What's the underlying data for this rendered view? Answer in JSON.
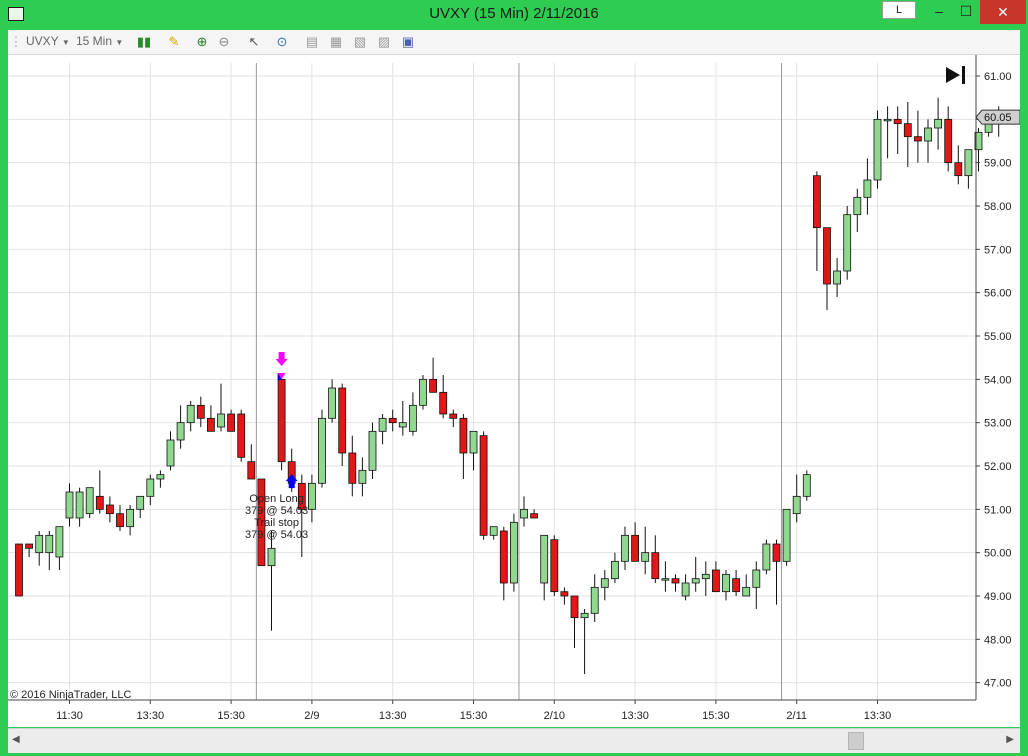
{
  "window": {
    "title": "UVXY (15 Min)  2/11/2016",
    "btn_l": "L",
    "btn_min": "‒",
    "btn_max": "☐",
    "btn_close": "✕"
  },
  "toolbar": {
    "instrument": "UVXY",
    "interval": "15 Min"
  },
  "chart": {
    "copyright": "© 2016 NinjaTrader, LLC",
    "last_price": "60.05",
    "y_ticks": [
      "61.00",
      "60.00",
      "59.00",
      "58.00",
      "57.00",
      "56.00",
      "55.00",
      "54.00",
      "53.00",
      "52.00",
      "51.00",
      "50.00",
      "49.00",
      "48.00",
      "47.00"
    ],
    "x_ticks": [
      "11:30",
      "13:30",
      "15:30",
      "2/9",
      "13:30",
      "15:30",
      "2/10",
      "13:30",
      "15:30",
      "2/11",
      "13:30"
    ],
    "annotations": {
      "entry_name": "Open Long",
      "entry_fill": "379 @ 54.03",
      "exit_name": "Trail stop",
      "exit_fill": "379 @ 54.03"
    },
    "colors": {
      "up": "#90d890",
      "down": "#e01818",
      "wick": "#111111",
      "grid": "#e2e2e2",
      "session": "#9a9a9a",
      "entry_arrow": "#ff00ff",
      "exit_arrow": "#0000ff"
    }
  },
  "chart_data": {
    "type": "candlestick",
    "ylim": [
      46.6,
      61.3
    ],
    "y_tick_values": [
      61,
      60,
      59,
      58,
      57,
      56,
      55,
      54,
      53,
      52,
      51,
      50,
      49,
      48,
      47
    ],
    "x_tick_bar_index": [
      5,
      13,
      21,
      29,
      37,
      45,
      53,
      61,
      69,
      77,
      85
    ],
    "session_breaks_after_bar": [
      23,
      49,
      75
    ],
    "bars": [
      [
        50.2,
        50.2,
        49.0,
        49.0
      ],
      [
        50.2,
        50.1,
        49.9,
        50.1
      ],
      [
        50.0,
        50.5,
        49.7,
        50.4
      ],
      [
        50.0,
        50.5,
        49.6,
        50.4
      ],
      [
        49.9,
        50.6,
        49.6,
        50.6
      ],
      [
        50.8,
        51.6,
        50.6,
        51.4
      ],
      [
        50.8,
        51.5,
        50.6,
        51.4
      ],
      [
        50.9,
        51.5,
        50.8,
        51.5
      ],
      [
        51.3,
        51.9,
        50.9,
        51.0
      ],
      [
        51.1,
        51.3,
        50.7,
        50.9
      ],
      [
        50.9,
        51.1,
        50.5,
        50.6
      ],
      [
        50.6,
        51.1,
        50.4,
        51.0
      ],
      [
        51.0,
        51.3,
        50.8,
        51.3
      ],
      [
        51.3,
        51.8,
        51.1,
        51.7
      ],
      [
        51.7,
        51.9,
        51.5,
        51.8
      ],
      [
        52.0,
        52.8,
        51.9,
        52.6
      ],
      [
        52.6,
        53.4,
        52.4,
        53.0
      ],
      [
        53.0,
        53.5,
        52.8,
        53.4
      ],
      [
        53.4,
        53.6,
        52.9,
        53.1
      ],
      [
        53.1,
        53.4,
        52.8,
        52.8
      ],
      [
        52.9,
        53.9,
        52.8,
        53.2
      ],
      [
        53.2,
        53.3,
        52.8,
        52.8
      ],
      [
        53.2,
        53.3,
        52.1,
        52.2
      ],
      [
        52.1,
        52.5,
        51.7,
        51.7
      ],
      [
        51.7,
        51.7,
        49.7,
        49.7
      ],
      [
        49.7,
        50.5,
        48.2,
        50.1
      ],
      [
        54.0,
        54.0,
        51.9,
        52.1
      ],
      [
        52.1,
        52.4,
        51.4,
        51.6
      ],
      [
        51.6,
        51.8,
        49.9,
        51.0
      ],
      [
        51.0,
        51.8,
        50.7,
        51.6
      ],
      [
        51.6,
        53.3,
        51.5,
        53.1
      ],
      [
        53.1,
        54.0,
        53.0,
        53.8
      ],
      [
        53.8,
        53.9,
        52.0,
        52.3
      ],
      [
        52.3,
        52.7,
        51.3,
        51.6
      ],
      [
        51.6,
        52.2,
        51.3,
        51.9
      ],
      [
        51.9,
        53.0,
        51.7,
        52.8
      ],
      [
        52.8,
        53.2,
        52.5,
        53.1
      ],
      [
        53.1,
        53.3,
        52.8,
        53.0
      ],
      [
        52.9,
        53.5,
        52.7,
        53.0
      ],
      [
        52.8,
        53.7,
        52.7,
        53.4
      ],
      [
        53.4,
        54.1,
        53.3,
        54.0
      ],
      [
        54.0,
        54.5,
        53.7,
        53.7
      ],
      [
        53.7,
        54.1,
        53.1,
        53.2
      ],
      [
        53.2,
        53.3,
        52.9,
        53.1
      ],
      [
        53.1,
        53.2,
        51.7,
        52.3
      ],
      [
        52.3,
        52.8,
        51.9,
        52.8
      ],
      [
        52.7,
        52.8,
        50.3,
        50.4
      ],
      [
        50.4,
        50.6,
        50.3,
        50.6
      ],
      [
        50.5,
        50.6,
        48.9,
        49.3
      ],
      [
        49.3,
        50.9,
        49.1,
        50.7
      ],
      [
        50.8,
        51.3,
        50.6,
        51.0
      ],
      [
        50.9,
        51.0,
        50.8,
        50.8
      ],
      [
        49.3,
        50.4,
        48.9,
        50.4
      ],
      [
        50.3,
        50.4,
        49.0,
        49.1
      ],
      [
        49.1,
        49.2,
        48.8,
        49.0
      ],
      [
        49.0,
        49.0,
        47.8,
        48.5
      ],
      [
        48.5,
        48.7,
        47.2,
        48.6
      ],
      [
        48.6,
        49.5,
        48.4,
        49.2
      ],
      [
        49.2,
        49.6,
        48.9,
        49.4
      ],
      [
        49.4,
        50.0,
        49.3,
        49.8
      ],
      [
        49.8,
        50.6,
        49.6,
        50.4
      ],
      [
        50.4,
        50.7,
        49.8,
        49.8
      ],
      [
        49.8,
        50.6,
        49.5,
        50.0
      ],
      [
        50.0,
        50.4,
        49.3,
        49.4
      ],
      [
        49.4,
        49.8,
        49.1,
        49.4
      ],
      [
        49.4,
        49.5,
        49.1,
        49.3
      ],
      [
        49.0,
        49.5,
        48.9,
        49.3
      ],
      [
        49.3,
        49.9,
        49.1,
        49.4
      ],
      [
        49.4,
        49.8,
        49.0,
        49.5
      ],
      [
        49.6,
        49.8,
        49.1,
        49.1
      ],
      [
        49.1,
        49.6,
        48.9,
        49.5
      ],
      [
        49.4,
        49.6,
        49.0,
        49.1
      ],
      [
        49.0,
        49.5,
        49.0,
        49.2
      ],
      [
        49.2,
        49.8,
        48.7,
        49.6
      ],
      [
        49.6,
        50.3,
        49.5,
        50.2
      ],
      [
        50.2,
        50.3,
        48.8,
        49.8
      ],
      [
        49.8,
        51.0,
        49.7,
        51.0
      ],
      [
        50.9,
        51.8,
        50.7,
        51.3
      ],
      [
        51.3,
        51.9,
        51.2,
        51.8
      ],
      [
        58.7,
        58.8,
        56.5,
        57.5
      ],
      [
        57.5,
        57.5,
        55.6,
        56.2
      ],
      [
        56.2,
        56.8,
        55.9,
        56.5
      ],
      [
        56.5,
        58.0,
        56.3,
        57.8
      ],
      [
        57.8,
        58.4,
        57.4,
        58.2
      ],
      [
        58.2,
        59.1,
        57.8,
        58.6
      ],
      [
        58.6,
        60.2,
        58.4,
        60.0
      ],
      [
        60.0,
        60.3,
        59.1,
        60.0
      ],
      [
        60.0,
        60.3,
        59.2,
        59.9
      ],
      [
        59.9,
        60.4,
        58.9,
        59.6
      ],
      [
        59.6,
        60.2,
        59.0,
        59.5
      ],
      [
        59.5,
        60.0,
        59.0,
        59.8
      ],
      [
        59.8,
        60.5,
        59.3,
        60.0
      ],
      [
        60.0,
        60.3,
        58.8,
        59.0
      ],
      [
        59.0,
        59.4,
        58.5,
        58.7
      ],
      [
        58.7,
        59.3,
        58.4,
        59.3
      ],
      [
        59.3,
        59.8,
        58.8,
        59.7
      ],
      [
        59.7,
        60.1,
        59.6,
        60.0
      ],
      [
        60.0,
        60.3,
        59.6,
        60.05
      ]
    ],
    "entry_bar_index": 26,
    "entry_price": 54.03,
    "exit_bar_index": 27,
    "exit_price": 51.95
  }
}
